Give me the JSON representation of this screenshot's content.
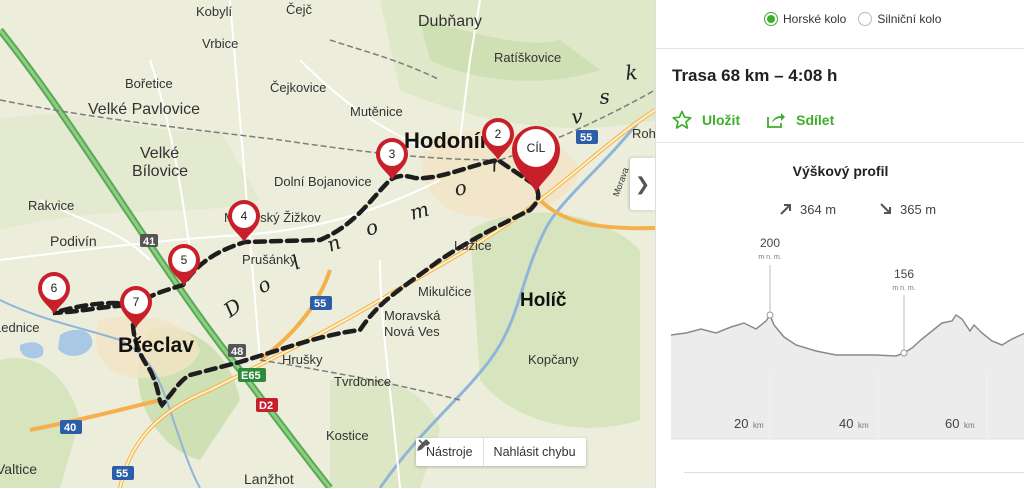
{
  "map": {
    "places": {
      "kobyli": "Kobylí",
      "cejc": "Čejč",
      "dubnany": "Dubňany",
      "vrbice": "Vrbice",
      "boretice": "Bořetice",
      "ratiskovice": "Ratíškovice",
      "velke_pavlovice": "Velké Pavlovice",
      "cejkovice": "Čejkovice",
      "mutenice": "Mutěnice",
      "hodonin": "Hodonín",
      "roh": "Roh",
      "velke": "Velké",
      "bilovice": "Bílovice",
      "dolni_bojanovice": "Dolní Bojanovice",
      "rakvice": "Rakvice",
      "moravsky_zizkov": "Moravský Žižkov",
      "podivin": "Podivín",
      "lusice": "Lužice",
      "prusanky": "Prušánky",
      "mikulcice": "Mikulčice",
      "holic": "Holíč",
      "lednice": "Lednice",
      "breclav": "Břeclav",
      "moravska": "Moravská",
      "nova_ves": "Nová Ves",
      "hrusky": "Hrušky",
      "kopcany": "Kopčany",
      "tvrdonice": "Tvrdonice",
      "kostice": "Kostice",
      "valtice": "Valtice",
      "lanzhot": "Lanžhot",
      "morava": "Morava"
    },
    "region_letters": [
      "D",
      "o",
      "l",
      "n",
      "o",
      "m",
      "o",
      "r",
      "a",
      "v",
      "s",
      "k"
    ],
    "roads": {
      "r41": "41",
      "r55a": "55",
      "r55b": "55",
      "r55c": "55",
      "r48": "48",
      "r40": "40",
      "e65": "E65",
      "d2": "D2"
    },
    "waypoints": [
      "2",
      "3",
      "4",
      "5",
      "6",
      "7"
    ],
    "finish_label": "CÍL",
    "tools": {
      "nastroje": "Nástroje",
      "nahlasit": "Nahlásit chybu"
    }
  },
  "panel": {
    "bike_types": [
      {
        "label": "Horské kolo",
        "selected": true
      },
      {
        "label": "Silniční kolo",
        "selected": false
      }
    ],
    "route_title": "Trasa 68 km – 4:08 h",
    "save_label": "Uložit",
    "share_label": "Sdílet",
    "profile_title": "Výškový profil",
    "ascent": "364 m",
    "descent": "365 m",
    "peaks": [
      {
        "value": "200",
        "unit": "m n. m."
      },
      {
        "value": "156",
        "unit": "m n. m."
      }
    ],
    "x_ticks": [
      {
        "value": "20",
        "unit": "km"
      },
      {
        "value": "40",
        "unit": "km"
      },
      {
        "value": "60",
        "unit": "km"
      }
    ],
    "colors": {
      "accent": "#3fae2a",
      "pin": "#c8202a"
    }
  }
}
